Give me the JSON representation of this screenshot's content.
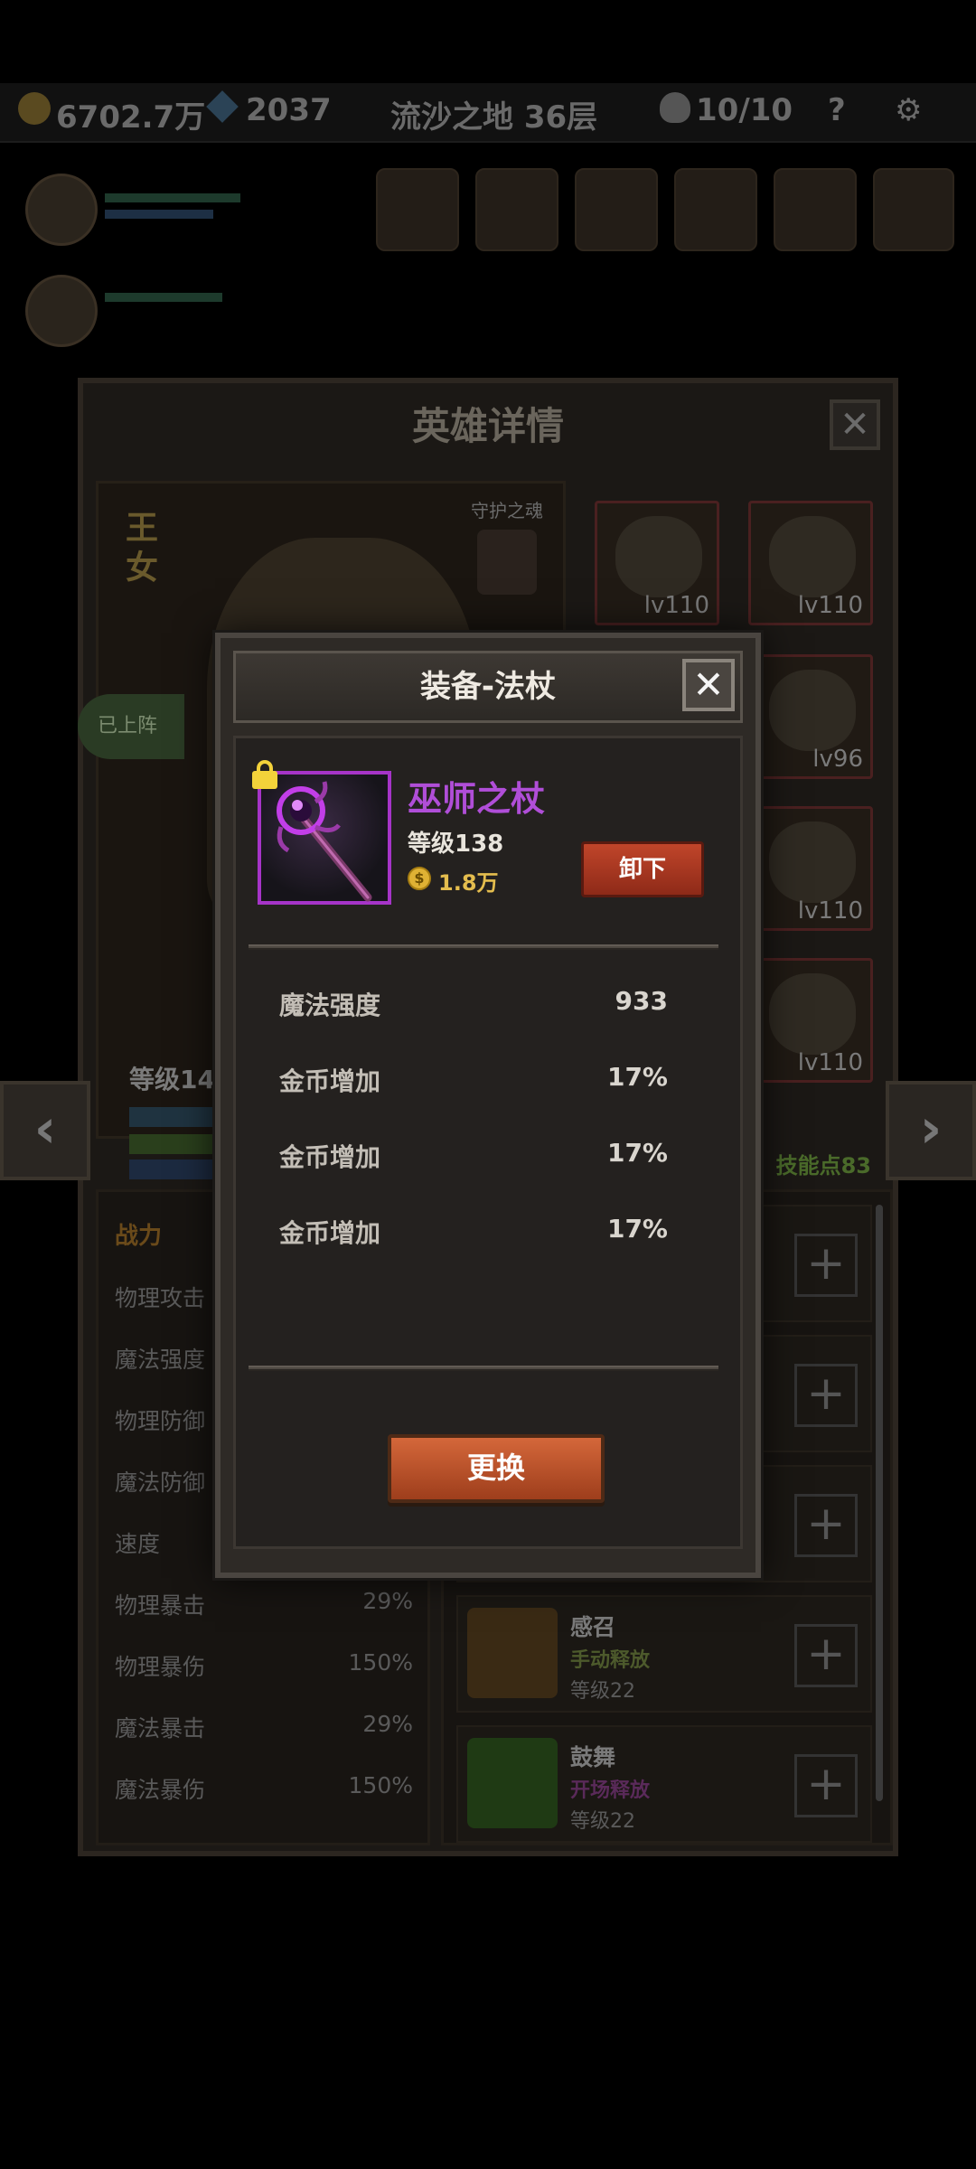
{
  "top_bar": {
    "gold": "6702.7万",
    "gems": "2037",
    "stage": "流沙之地 36层",
    "kills": "10/10",
    "help": "?"
  },
  "hero_details": {
    "title": "英雄详情",
    "close": "✕",
    "hero_name": "王女",
    "guardian_label": "守护之魂",
    "deployed_label": "已上阵",
    "level": "等级143",
    "skill_points": "技能点83",
    "equipment_levels": [
      "lv110",
      "lv110",
      "lv96",
      "lv110",
      "lv110"
    ],
    "stats_header": "战力",
    "stats": [
      {
        "name": "物理攻击",
        "value": ""
      },
      {
        "name": "魔法强度",
        "value": ""
      },
      {
        "name": "物理防御",
        "value": ""
      },
      {
        "name": "魔法防御",
        "value": ""
      },
      {
        "name": "速度",
        "value": ""
      },
      {
        "name": "物理暴击",
        "value": "29%"
      },
      {
        "name": "物理暴伤",
        "value": "150%"
      },
      {
        "name": "魔法暴击",
        "value": "29%"
      },
      {
        "name": "魔法暴伤",
        "value": "150%"
      }
    ],
    "skills": [
      {
        "name": "感召",
        "type": "手动释放",
        "level": "等级22"
      },
      {
        "name": "鼓舞",
        "type": "开场释放",
        "level": "等级22"
      }
    ],
    "plus": "+",
    "nav_prev": "‹",
    "nav_next": "›"
  },
  "modal": {
    "title": "装备-法杖",
    "close": "✕",
    "item_name": "巫师之杖",
    "item_level": "等级138",
    "coin_symbol": "$",
    "item_price": "1.8万",
    "unequip_label": "卸下",
    "attributes": [
      {
        "name": "魔法强度",
        "value": "933"
      },
      {
        "name": "金币增加",
        "value": "17%"
      },
      {
        "name": "金币增加",
        "value": "17%"
      },
      {
        "name": "金币增加",
        "value": "17%"
      }
    ],
    "swap_label": "更换"
  },
  "colors": {
    "epic_purple": "#b04ed8",
    "gold_text": "#e4bd4e",
    "button_red": "#c0452a",
    "button_orange": "#d4673a"
  },
  "icons": [
    "coin-icon",
    "gem-icon",
    "skull-icon",
    "lock-icon",
    "staff-icon",
    "close-icon",
    "plus-icon",
    "chevron-left-icon",
    "chevron-right-icon"
  ]
}
